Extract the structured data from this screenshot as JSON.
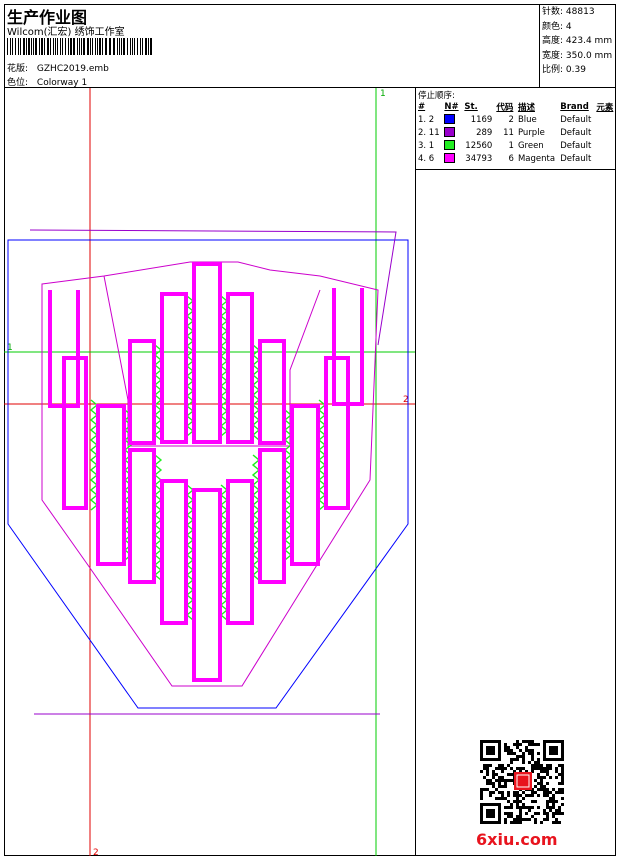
{
  "header": {
    "title": "生产作业图",
    "subtitle": "Wilcom(汇宏) 绣饰工作室",
    "design_label": "花版:",
    "design_value": "GZHC2019.emb",
    "colorway_label": "色位:",
    "colorway_value": "Colorway 1"
  },
  "stats": [
    {
      "label": "针数:",
      "value": "48813"
    },
    {
      "label": "颜色:",
      "value": "4"
    },
    {
      "label": "高度:",
      "value": "423.4 mm"
    },
    {
      "label": "宽度:",
      "value": "350.0 mm"
    },
    {
      "label": "比例:",
      "value": "0.39"
    }
  ],
  "stop_sequence": {
    "title": "停止顺序:",
    "columns": [
      "#",
      "N#",
      "St.",
      "代码",
      "描述",
      "Brand",
      "元素"
    ],
    "rows": [
      {
        "seq": "1. 2",
        "stitches": "1169",
        "code": "2",
        "desc": "Blue",
        "brand": "Default",
        "color": "#0000ff"
      },
      {
        "seq": "2. 11",
        "stitches": "289",
        "code": "11",
        "desc": "Purple",
        "brand": "Default",
        "color": "#9900cc"
      },
      {
        "seq": "3. 1",
        "stitches": "12560",
        "code": "1",
        "desc": "Green",
        "brand": "Default",
        "color": "#22ee22"
      },
      {
        "seq": "4. 6",
        "stitches": "34793",
        "code": "6",
        "desc": "Magenta",
        "brand": "Default",
        "color": "#ff00ff"
      }
    ]
  },
  "guides": {
    "vertical_green": "1",
    "horizontal_green": "1",
    "vertical_red": "2",
    "horizontal_red": "2"
  },
  "watermark": "6xiu.com",
  "colors": {
    "blue": "#0000ff",
    "purple": "#9900cc",
    "green": "#22ee22",
    "magenta": "#ff00ff",
    "red_guide": "#e00000",
    "green_guide": "#00cc00"
  }
}
